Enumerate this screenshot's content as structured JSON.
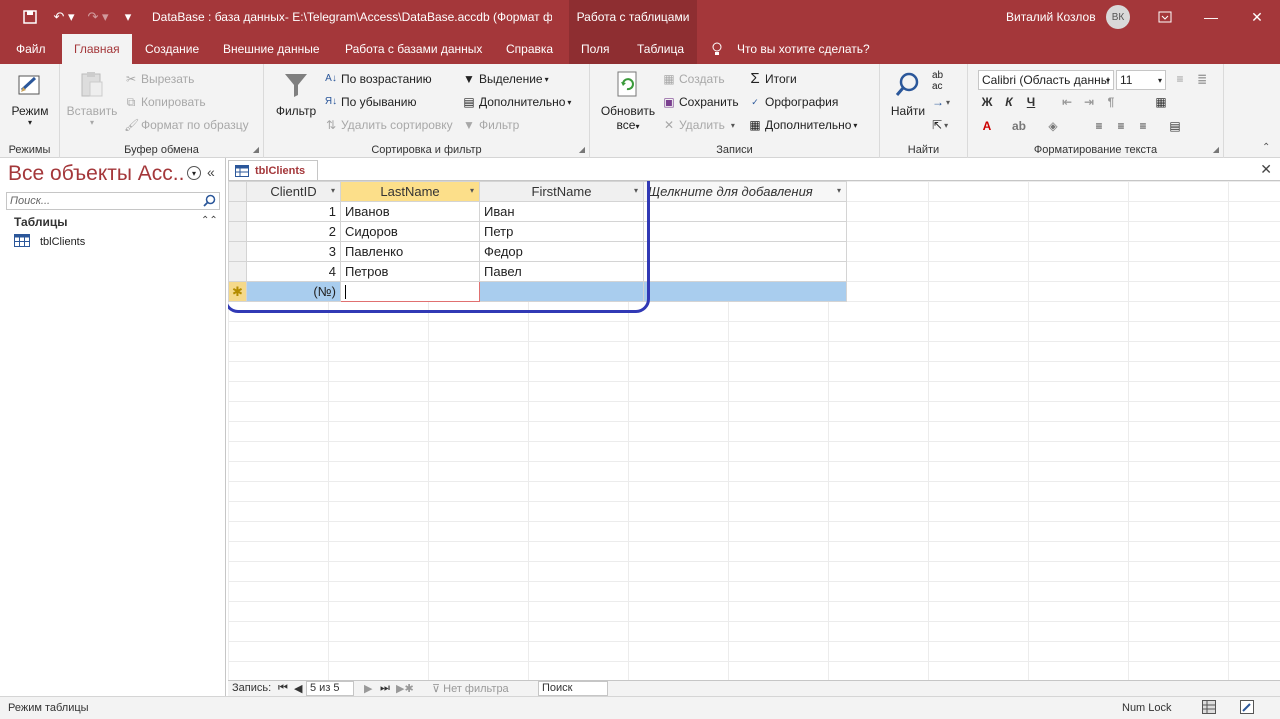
{
  "titlebar": {
    "doc_title": "DataBase : база данных- E:\\Telegram\\Access\\DataBase.accdb (Формат фа...",
    "context_tab": "Работа с таблицами",
    "user_name": "Виталий Козлов",
    "user_initials": "ВК",
    "minimize": "—",
    "maximize": "☐",
    "close": "✕"
  },
  "tabs": {
    "file": "Файл",
    "home": "Главная",
    "create": "Создание",
    "external": "Внешние данные",
    "database": "Работа с базами данных",
    "help": "Справка",
    "fields": "Поля",
    "table": "Таблица",
    "tell_me": "Что вы хотите сделать?"
  },
  "ribbon": {
    "views": {
      "view_label": "Режим",
      "group": "Режимы"
    },
    "clipboard": {
      "paste": "Вставить",
      "cut": "Вырезать",
      "copy": "Копировать",
      "format_painter": "Формат по образцу",
      "group": "Буфер обмена"
    },
    "sort": {
      "filter": "Фильтр",
      "ascending": "По возрастанию",
      "descending": "По убыванию",
      "remove_sort": "Удалить сортировку",
      "selection": "Выделение",
      "advanced": "Дополнительно",
      "toggle_filter": "Фильтр",
      "group": "Сортировка и фильтр"
    },
    "records": {
      "refresh": "Обновить",
      "refresh2": "все",
      "new": "Создать",
      "save": "Сохранить",
      "delete": "Удалить",
      "totals": "Итоги",
      "spelling": "Орфография",
      "more": "Дополнительно",
      "group": "Записи"
    },
    "find": {
      "find": "Найти",
      "group": "Найти"
    },
    "text": {
      "font": "Calibri (Область данны",
      "size": "11",
      "bold": "Ж",
      "italic": "К",
      "underline": "Ч",
      "group": "Форматирование текста"
    }
  },
  "nav": {
    "title": "Все объекты Acc...",
    "search_placeholder": "Поиск...",
    "section": "Таблицы",
    "items": [
      "tblClients"
    ]
  },
  "document": {
    "tab_label": "tblClients",
    "columns": [
      "ClientID",
      "LastName",
      "FirstName",
      "Щелкните для добавления"
    ],
    "rows": [
      [
        "1",
        "Иванов",
        "Иван"
      ],
      [
        "2",
        "Сидоров",
        "Петр"
      ],
      [
        "3",
        "Павленко",
        "Федор"
      ],
      [
        "4",
        "Петров",
        "Павел"
      ]
    ],
    "new_row_id": "(№)"
  },
  "record_nav": {
    "label": "Запись:",
    "position": "5 из 5",
    "no_filter": "Нет фильтра",
    "search": "Поиск"
  },
  "status": {
    "mode": "Режим таблицы",
    "numlock": "Num Lock"
  },
  "colors": {
    "accent": "#a4373a",
    "highlight": "#3139b5"
  }
}
